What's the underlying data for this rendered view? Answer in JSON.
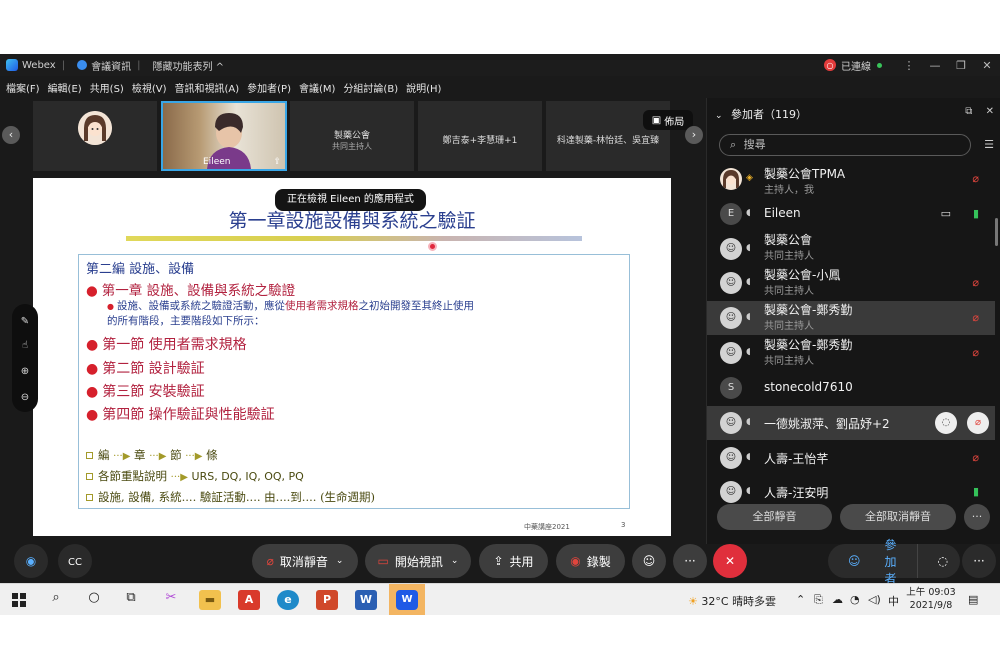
{
  "titlebar": {
    "app_name": "Webex",
    "meeting_info": "會議資訊",
    "hide_menu": "隱藏功能表列 ^",
    "connection_status": "已連線",
    "rec_glyph": "○"
  },
  "menu": [
    "檔案(F)",
    "編輯(E)",
    "共用(S)",
    "檢視(V)",
    "音訊和視訊(A)",
    "參加者(P)",
    "會議(M)",
    "分組討論(B)",
    "說明(H)"
  ],
  "video_strip": {
    "tiles": [
      {
        "name": "Eileen"
      },
      {
        "name": "製藥公會",
        "sub": "共同主持人"
      },
      {
        "name": "鄭吉泰+李慧珊+1"
      },
      {
        "name": "科達製藥-林怡廷、吳宜臻"
      }
    ],
    "layout_label": "佈局"
  },
  "share_banner": "正在檢視 Eileen 的應用程式",
  "slide": {
    "title": "第一章設施設備與系統之驗証",
    "heading": "第二編 設施、設備",
    "bullet_main": "第一章 設施、設備與系統之驗證",
    "sub_line1_a": "設施、設備或系統之驗證活動，應從",
    "sub_line1_b": "使用者需求規格",
    "sub_line1_c": "之初始開發至其終止使用",
    "sub_line2": "的所有階段，主要階段如下所示：",
    "sections": [
      "第一節 使用者需求規格",
      "第二節 設計驗証",
      "第三節 安裝驗証",
      "第四節 操作驗証與性能驗証"
    ],
    "legend": [
      {
        "parts": [
          "編",
          "章",
          "節",
          "條"
        ]
      },
      {
        "text": "各節重點說明",
        "after": "URS, DQ, IQ, OQ, PQ"
      },
      {
        "text": "設施, 設備, 系統.... 驗証活動.... 由....到.... (生命週期)"
      }
    ],
    "footer": "中藥講座2021",
    "page": "3"
  },
  "controls": {
    "unmute": "取消靜音",
    "start_video": "開始視訊",
    "share": "共用",
    "record": "錄製",
    "more": "···",
    "participants": "參加者",
    "chat": "聊天"
  },
  "panel": {
    "title": "參加者（119）",
    "search_placeholder": "搜尋",
    "participants": [
      {
        "name": "製藥公會TPMA",
        "role": "主持人，我",
        "mic": "off"
      },
      {
        "name": "Eileen",
        "role": "",
        "mic": "on",
        "initial": "E"
      },
      {
        "name": "製藥公會",
        "role": "共同主持人",
        "mic": "none"
      },
      {
        "name": "製藥公會-小鳳",
        "role": "共同主持人",
        "mic": "off"
      },
      {
        "name": "製藥公會-鄭秀勤",
        "role": "共同主持人",
        "mic": "off"
      },
      {
        "name": "製藥公會-鄭秀勤",
        "role": "共同主持人",
        "mic": "off"
      },
      {
        "name": "stonecold7610",
        "role": "",
        "mic": "none",
        "initial": "S"
      },
      {
        "name": "一德姚淑萍、劉品妤+2",
        "role": "",
        "mic": "off"
      },
      {
        "name": "人壽-王怡芊",
        "role": "",
        "mic": "off"
      },
      {
        "name": "人壽-汪安明",
        "role": "",
        "mic": "on"
      }
    ],
    "mute_all": "全部靜音",
    "unmute_all": "全部取消靜音"
  },
  "taskbar": {
    "temperature": "32°C",
    "weather": "晴時多雲",
    "ime": "中",
    "time": "上午 09:03",
    "date": "2021/9/8"
  }
}
